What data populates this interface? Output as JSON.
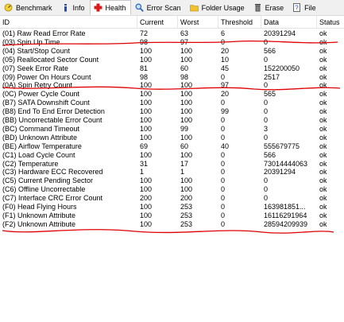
{
  "toolbar": {
    "tabs": [
      {
        "label": "Benchmark",
        "icon": "benchmark-icon",
        "active": false
      },
      {
        "label": "Info",
        "icon": "info-icon",
        "active": false
      },
      {
        "label": "Health",
        "icon": "health-cross-icon",
        "active": true
      },
      {
        "label": "Error Scan",
        "icon": "magnifier-icon",
        "active": false
      },
      {
        "label": "Folder Usage",
        "icon": "folder-icon",
        "active": false
      },
      {
        "label": "Erase",
        "icon": "trash-icon",
        "active": false
      },
      {
        "label": "File",
        "icon": "file-icon",
        "active": false
      }
    ]
  },
  "table": {
    "columns": {
      "id": "ID",
      "current": "Current",
      "worst": "Worst",
      "threshold": "Threshold",
      "data": "Data",
      "status": "Status"
    },
    "rows": [
      [
        "(01) Raw Read Error Rate",
        "72",
        "63",
        "6",
        "20391294",
        "ok"
      ],
      [
        "(03) Spin Up Time",
        "98",
        "97",
        "0",
        "0",
        "ok"
      ],
      [
        "(04) Start/Stop Count",
        "100",
        "100",
        "20",
        "566",
        "ok"
      ],
      [
        "(05) Reallocated Sector Count",
        "100",
        "100",
        "10",
        "0",
        "ok"
      ],
      [
        "(07) Seek Error Rate",
        "81",
        "60",
        "45",
        "152200050",
        "ok"
      ],
      [
        "(09) Power On Hours Count",
        "98",
        "98",
        "0",
        "2517",
        "ok"
      ],
      [
        "(0A) Spin Retry Count",
        "100",
        "100",
        "97",
        "0",
        "ok"
      ],
      [
        "(0C) Power Cycle Count",
        "100",
        "100",
        "20",
        "565",
        "ok"
      ],
      [
        "(B7) SATA Downshift Count",
        "100",
        "100",
        "0",
        "0",
        "ok"
      ],
      [
        "(B8) End To End Error Detection",
        "100",
        "100",
        "99",
        "0",
        "ok"
      ],
      [
        "(BB) Uncorrectable Error Count",
        "100",
        "100",
        "0",
        "0",
        "ok"
      ],
      [
        "(BC) Command Timeout",
        "100",
        "99",
        "0",
        "3",
        "ok"
      ],
      [
        "(BD) Unknown Attribute",
        "100",
        "100",
        "0",
        "0",
        "ok"
      ],
      [
        "(BE) Airflow Temperature",
        "69",
        "60",
        "40",
        "555679775",
        "ok"
      ],
      [
        "(C1) Load Cycle Count",
        "100",
        "100",
        "0",
        "566",
        "ok"
      ],
      [
        "(C2) Temperature",
        "31",
        "17",
        "0",
        "73014444063",
        "ok"
      ],
      [
        "(C3) Hardware ECC Recovered",
        "1",
        "1",
        "0",
        "20391294",
        "ok"
      ],
      [
        "(C5) Current Pending Sector",
        "100",
        "100",
        "0",
        "0",
        "ok"
      ],
      [
        "(C6) Offline Uncorrectable",
        "100",
        "100",
        "0",
        "0",
        "ok"
      ],
      [
        "(C7) Interface CRC Error Count",
        "200",
        "200",
        "0",
        "0",
        "ok"
      ],
      [
        "(F0) Head Flying Hours",
        "100",
        "253",
        "0",
        "163981851...",
        "ok"
      ],
      [
        "(F1) Unknown Attribute",
        "100",
        "253",
        "0",
        "16116291964",
        "ok"
      ],
      [
        "(F2) Unknown Attribute",
        "100",
        "253",
        "0",
        "28594209939",
        "ok"
      ]
    ]
  },
  "annotation_color": "#e00000"
}
